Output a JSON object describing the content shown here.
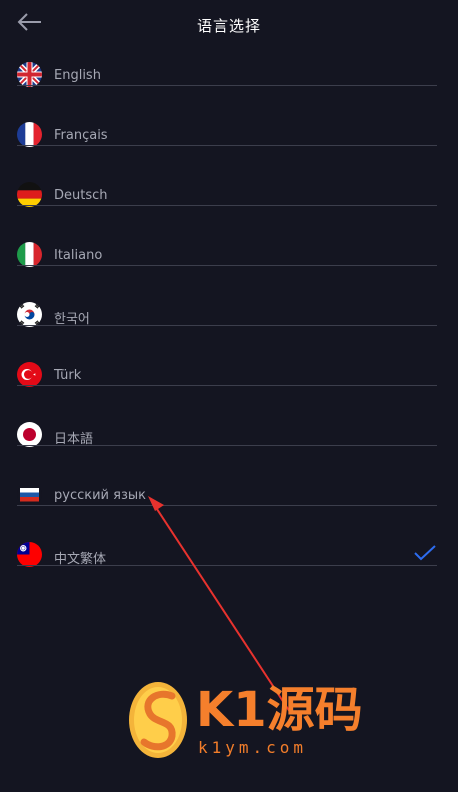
{
  "header": {
    "title": "语言选择",
    "back_icon": "arrow-left-icon"
  },
  "languages": [
    {
      "label": "English",
      "flag": "uk-flag-icon",
      "selected": false
    },
    {
      "label": "Français",
      "flag": "france-flag-icon",
      "selected": false
    },
    {
      "label": "Deutsch",
      "flag": "germany-flag-icon",
      "selected": false
    },
    {
      "label": "Italiano",
      "flag": "italy-flag-icon",
      "selected": false
    },
    {
      "label": "한국어",
      "flag": "korea-flag-icon",
      "selected": false
    },
    {
      "label": "Türk",
      "flag": "turkey-flag-icon",
      "selected": false
    },
    {
      "label": "日本語",
      "flag": "japan-flag-icon",
      "selected": false
    },
    {
      "label": "русский язык",
      "flag": "russia-flag-icon",
      "selected": false
    },
    {
      "label": "中文繁体",
      "flag": "taiwan-flag-icon",
      "selected": true
    }
  ],
  "selected_indicator": "checkmark-icon",
  "watermark": {
    "brand": "K1源码",
    "url": "k1ym.com"
  },
  "colors": {
    "background": "#141521",
    "label": "#a6a8b4",
    "divider": "#3c3e4c",
    "check": "#2d6cf0",
    "annotation_arrow": "#e8322e",
    "watermark": "#f27d2a"
  }
}
